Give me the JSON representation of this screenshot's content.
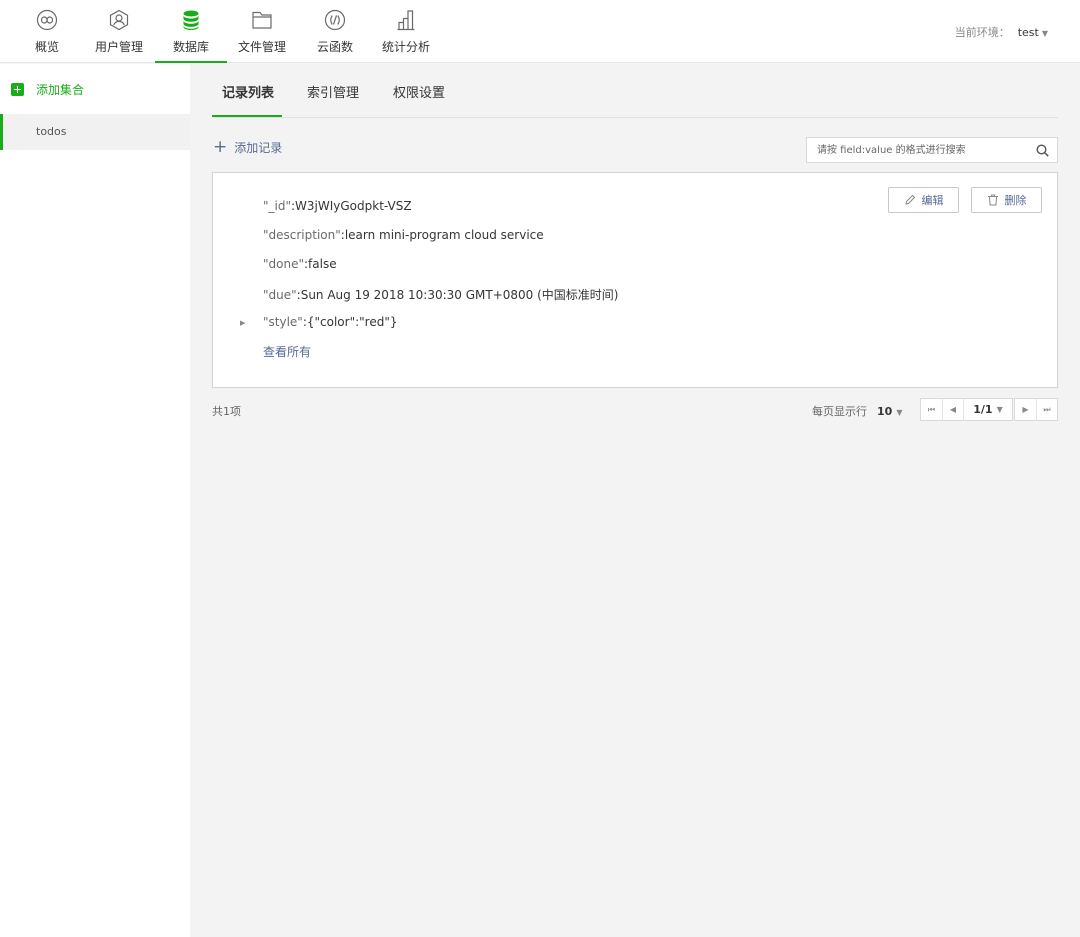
{
  "nav": {
    "items": [
      {
        "label": "概览",
        "icon": "overview-icon"
      },
      {
        "label": "用户管理",
        "icon": "user-icon"
      },
      {
        "label": "数据库",
        "icon": "database-icon"
      },
      {
        "label": "文件管理",
        "icon": "folder-icon"
      },
      {
        "label": "云函数",
        "icon": "function-icon"
      },
      {
        "label": "统计分析",
        "icon": "chart-icon"
      }
    ],
    "active": "数据库",
    "env_label": "当前环境：",
    "env_value": "test"
  },
  "sidebar": {
    "add_label": "添加集合",
    "collections": [
      "todos"
    ]
  },
  "tabs": [
    "记录列表",
    "索引管理",
    "权限设置"
  ],
  "toolbar": {
    "add_record": "添加记录",
    "search_placeholder": "请按 field:value 的格式进行搜索"
  },
  "record": {
    "fields": [
      {
        "key": "\"_id\"",
        "sep": ":",
        "value": "W3jWIyGodpkt-VSZ"
      },
      {
        "key": "\"description\"",
        "sep": ":",
        "value": "learn mini-program cloud service"
      },
      {
        "key": "\"done\"",
        "sep": ":",
        "value": "false"
      },
      {
        "key": "\"due\"",
        "sep": ":",
        "value": "Sun Aug 19 2018 10:30:30 GMT+0800 (中国标准时间)"
      },
      {
        "key": "\"style\"",
        "sep": ":",
        "value": "{\"color\":\"red\"}"
      }
    ],
    "view_all": "查看所有",
    "edit_label": "编辑",
    "delete_label": "删除"
  },
  "footer": {
    "total": "共1项",
    "per_page_label": "每页显示行",
    "per_page_value": "10",
    "page_indicator": "1/1"
  },
  "colors": {
    "accent": "#1aad19",
    "link": "#576b95"
  }
}
